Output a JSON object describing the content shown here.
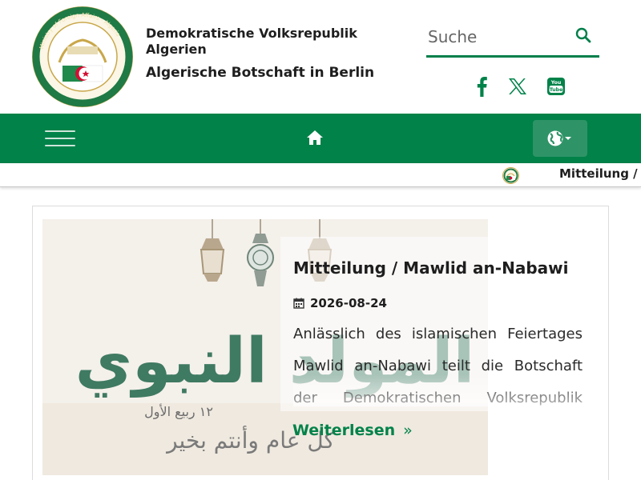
{
  "header": {
    "org_line1": "Demokratische Volksrepublik Algerien",
    "org_line2": "Algerische Botschaft in Berlin",
    "logo_text": "Ministry of Foreign Affairs - Algeria"
  },
  "search": {
    "placeholder": "Suche",
    "icon": "search-icon"
  },
  "social": {
    "icons": [
      "facebook-icon",
      "x-twitter-icon",
      "youtube-icon"
    ]
  },
  "nav": {
    "icons": [
      "hamburger-menu-icon",
      "home-icon",
      "globe-language-icon"
    ]
  },
  "ticker": {
    "text": "Mitteilung / Mawlid an-Nabawi"
  },
  "article": {
    "title": "Mitteilung / Mawlid an-Nabawi",
    "date": "2026-08-24",
    "excerpt": "Anlässlich des islamischen Feiertages Mawlid an-Nabawi teilt die Botschaft der Demokratischen Volksrepublik Algerien mit",
    "read_more": "Weiterlesen",
    "read_more_chevron": "»",
    "image_caption_ar": "المولد النبوي",
    "image_subcaption_ar": "١٢ ربيع الأول",
    "image_greeting_ar": "كل عام وأنتم بخير"
  },
  "colors": {
    "primary_green": "#008249",
    "nav_button": "#2e9467",
    "red": "#d21034"
  }
}
